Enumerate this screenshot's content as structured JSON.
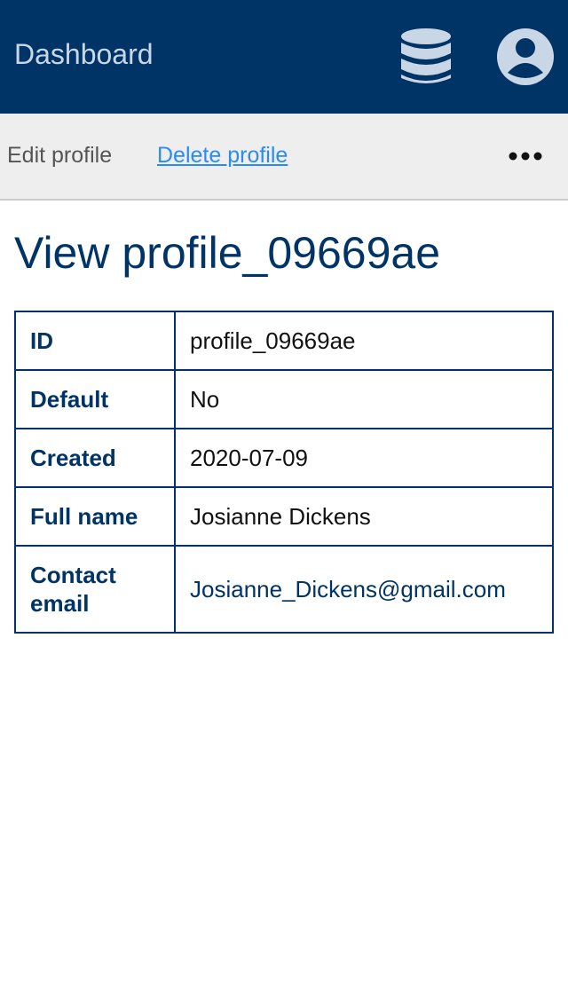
{
  "header": {
    "title": "Dashboard",
    "icons": [
      "database-icon",
      "user-account-icon"
    ],
    "background_color": "#003366"
  },
  "actions": {
    "edit_label": "Edit profile",
    "delete_label": "Delete profile",
    "more_icon": "ellipsis-icon"
  },
  "main": {
    "heading": "View profile_09669ae",
    "rows": [
      {
        "label": "ID",
        "value": "profile_09669ae"
      },
      {
        "label": "Default",
        "value": "No"
      },
      {
        "label": "Created",
        "value": "2020-07-09"
      },
      {
        "label": "Full name",
        "value": "Josianne Dickens"
      },
      {
        "label": "Contact email",
        "value": "Josianne_Dickens@gmail.com"
      }
    ]
  },
  "colors": {
    "brand": "#003366",
    "link": "#2a8cf0",
    "actionbar_bg": "#eeeeee"
  }
}
